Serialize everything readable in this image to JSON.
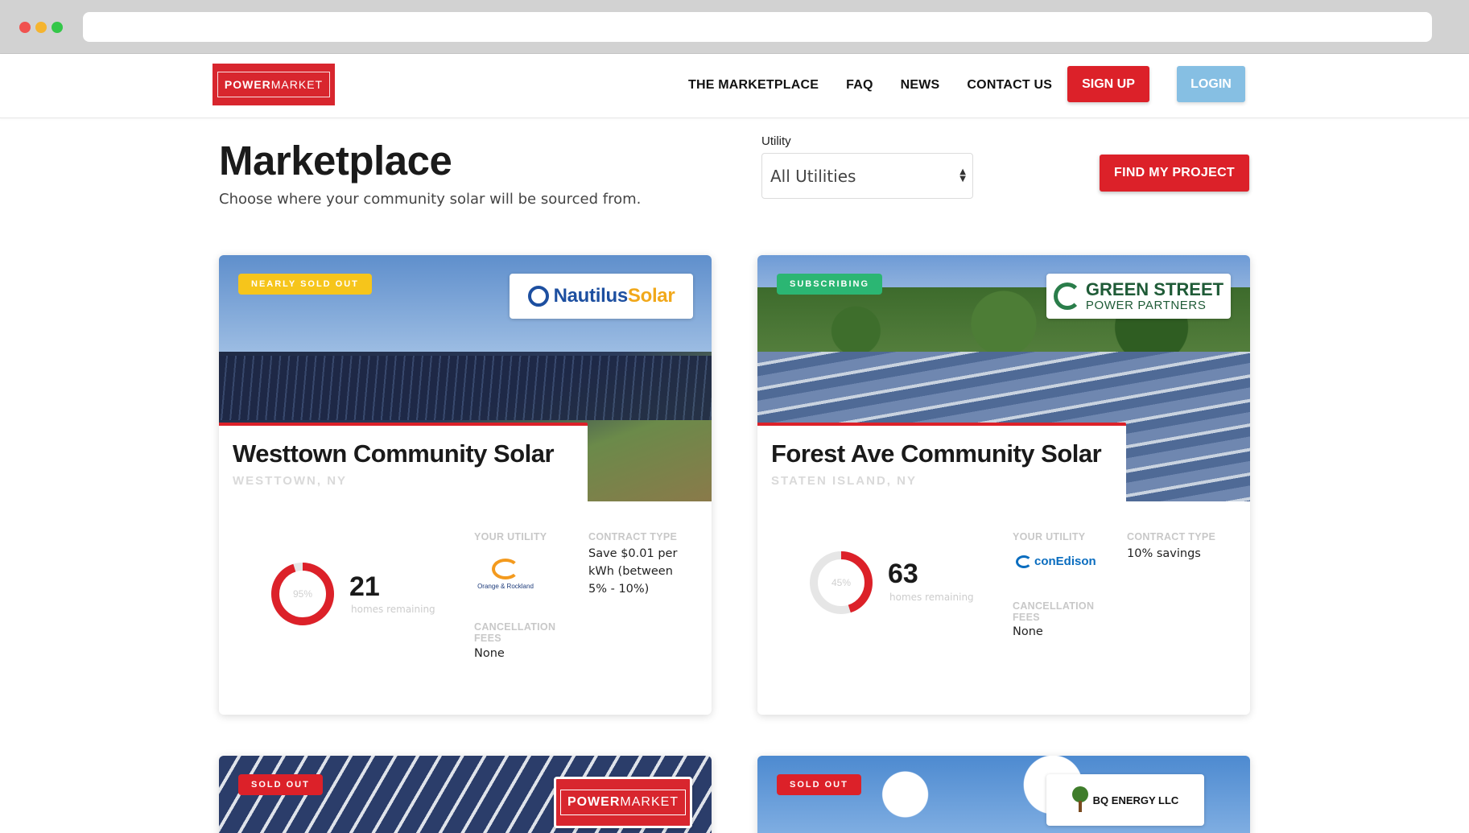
{
  "nav": {
    "logo_bold": "POWER",
    "logo_light": "MARKET",
    "links": [
      "THE MARKETPLACE",
      "FAQ",
      "NEWS",
      "CONTACT US"
    ],
    "signup": "SIGN UP",
    "login": "LOGIN"
  },
  "header": {
    "title": "Marketplace",
    "subtitle": "Choose where your community solar will be sourced from.",
    "utility_label": "Utility",
    "utility_value": "All Utilities",
    "find_button": "FIND MY PROJECT"
  },
  "labels": {
    "homes_remaining": "homes remaining",
    "your_utility": "YOUR UTILITY",
    "contract_type": "CONTRACT TYPE",
    "cancellation_fees_line1": "CANCELLATION",
    "cancellation_fees_line2": "FEES"
  },
  "cards": [
    {
      "badge": "NEARLY SOLD OUT",
      "partner_a": "Nautilus",
      "partner_b": "Solar",
      "title": "Westtown Community Solar",
      "location": "WESTTOWN, NY",
      "percent_label": "95%",
      "percent": 95,
      "homes": "21",
      "utility_name": "Orange & Rockland",
      "contract": "Save $0.01 per kWh (between 5% - 10%)",
      "cancellation": "None",
      "ring_color": "#dc2129"
    },
    {
      "badge": "SUBSCRIBING",
      "partner_a": "GREEN STREET",
      "partner_b": "POWER PARTNERS",
      "title": "Forest Ave Community Solar",
      "location": "STATEN ISLAND, NY",
      "percent_label": "45%",
      "percent": 45,
      "homes": "63",
      "utility_name": "conEdison",
      "contract": "10% savings",
      "cancellation": "None",
      "ring_color": "#dc2129"
    },
    {
      "badge": "SOLD OUT",
      "partner_a": "POWER",
      "partner_b": "MARKET"
    },
    {
      "badge": "SOLD OUT",
      "partner_a": "BQ ENERGY LLC"
    }
  ]
}
